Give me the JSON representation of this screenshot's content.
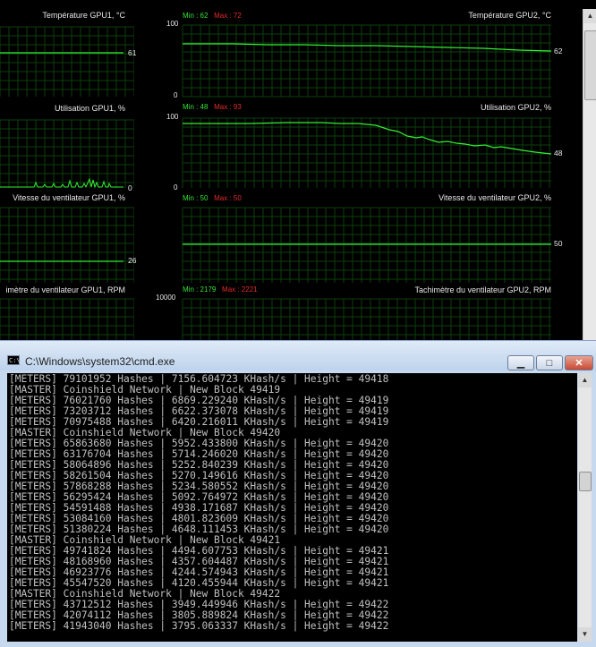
{
  "monitor": {
    "gpu1": {
      "temperature": {
        "title": "Température GPU1, °C",
        "current": "61",
        "level": 0.61
      },
      "usage": {
        "title": "Utilisation GPU1, %",
        "current": "0"
      },
      "fan_percent": {
        "title": "Vitesse du ventilateur GPU1, %",
        "current": "26",
        "level": 0.26
      },
      "fan_rpm": {
        "title": "imètre du ventilateur GPU1, RPM"
      }
    },
    "gpu2": {
      "temperature": {
        "title": "Température GPU2, °C",
        "min_label": "Min : 62",
        "max_label": "Max : 72",
        "axis_max": "100",
        "axis_min": "0",
        "current": "62",
        "start_level": 0.66,
        "end_level": 0.62
      },
      "usage": {
        "title": "Utilisation GPU2, %",
        "min_label": "Min : 48",
        "max_label": "Max : 93",
        "axis_max": "100",
        "axis_min": "0",
        "current": "48",
        "start_level": 0.88,
        "end_level": 0.48
      },
      "fan_percent": {
        "title": "Vitesse du ventilateur GPU2, %",
        "min_label": "Min : 50",
        "max_label": "Max : 50",
        "current": "50",
        "level": 0.5
      },
      "fan_rpm": {
        "title": "Tachimètre du ventilateur GPU2, RPM",
        "min_label": "Min : 2179",
        "max_label": "Max : 2221",
        "axis_max": "10000"
      }
    },
    "colors": {
      "line": "#33ee33",
      "grid": "#0d3f0d",
      "min": "#35e135",
      "max": "#e22b2b"
    }
  },
  "window": {
    "title": "C:\\Windows\\system32\\cmd.exe",
    "icon_text": "C:\\",
    "min_glyph": "▁",
    "max_glyph": "□",
    "close_glyph": "✕"
  },
  "console": {
    "lines": [
      "[METERS] 79101952 Hashes | 7156.604723 KHash/s | Height = 49418",
      "[MASTER] Coinshield Network | New Block 49419",
      "[METERS] 76021760 Hashes | 6869.229240 KHash/s | Height = 49419",
      "[METERS] 73203712 Hashes | 6622.373078 KHash/s | Height = 49419",
      "[METERS] 70975488 Hashes | 6420.216011 KHash/s | Height = 49419",
      "[MASTER] Coinshield Network | New Block 49420",
      "[METERS] 65863680 Hashes | 5952.433800 KHash/s | Height = 49420",
      "[METERS] 63176704 Hashes | 5714.246020 KHash/s | Height = 49420",
      "[METERS] 58064896 Hashes | 5252.840239 KHash/s | Height = 49420",
      "[METERS] 58261504 Hashes | 5270.149616 KHash/s | Height = 49420",
      "[METERS] 57868288 Hashes | 5234.580552 KHash/s | Height = 49420",
      "[METERS] 56295424 Hashes | 5092.764972 KHash/s | Height = 49420",
      "[METERS] 54591488 Hashes | 4938.171687 KHash/s | Height = 49420",
      "[METERS] 53084160 Hashes | 4801.823609 KHash/s | Height = 49420",
      "[METERS] 51380224 Hashes | 4648.111453 KHash/s | Height = 49420",
      "[MASTER] Coinshield Network | New Block 49421",
      "[METERS] 49741824 Hashes | 4494.607753 KHash/s | Height = 49421",
      "[METERS] 48168960 Hashes | 4357.604487 KHash/s | Height = 49421",
      "[METERS] 46923776 Hashes | 4244.574943 KHash/s | Height = 49421",
      "[METERS] 45547520 Hashes | 4120.455944 KHash/s | Height = 49421",
      "[MASTER] Coinshield Network | New Block 49422",
      "[METERS] 43712512 Hashes | 3949.449946 KHash/s | Height = 49422",
      "[METERS] 42074112 Hashes | 3805.889824 KHash/s | Height = 49422",
      "[METERS] 41943040 Hashes | 3795.063337 KHash/s | Height = 49422"
    ]
  }
}
